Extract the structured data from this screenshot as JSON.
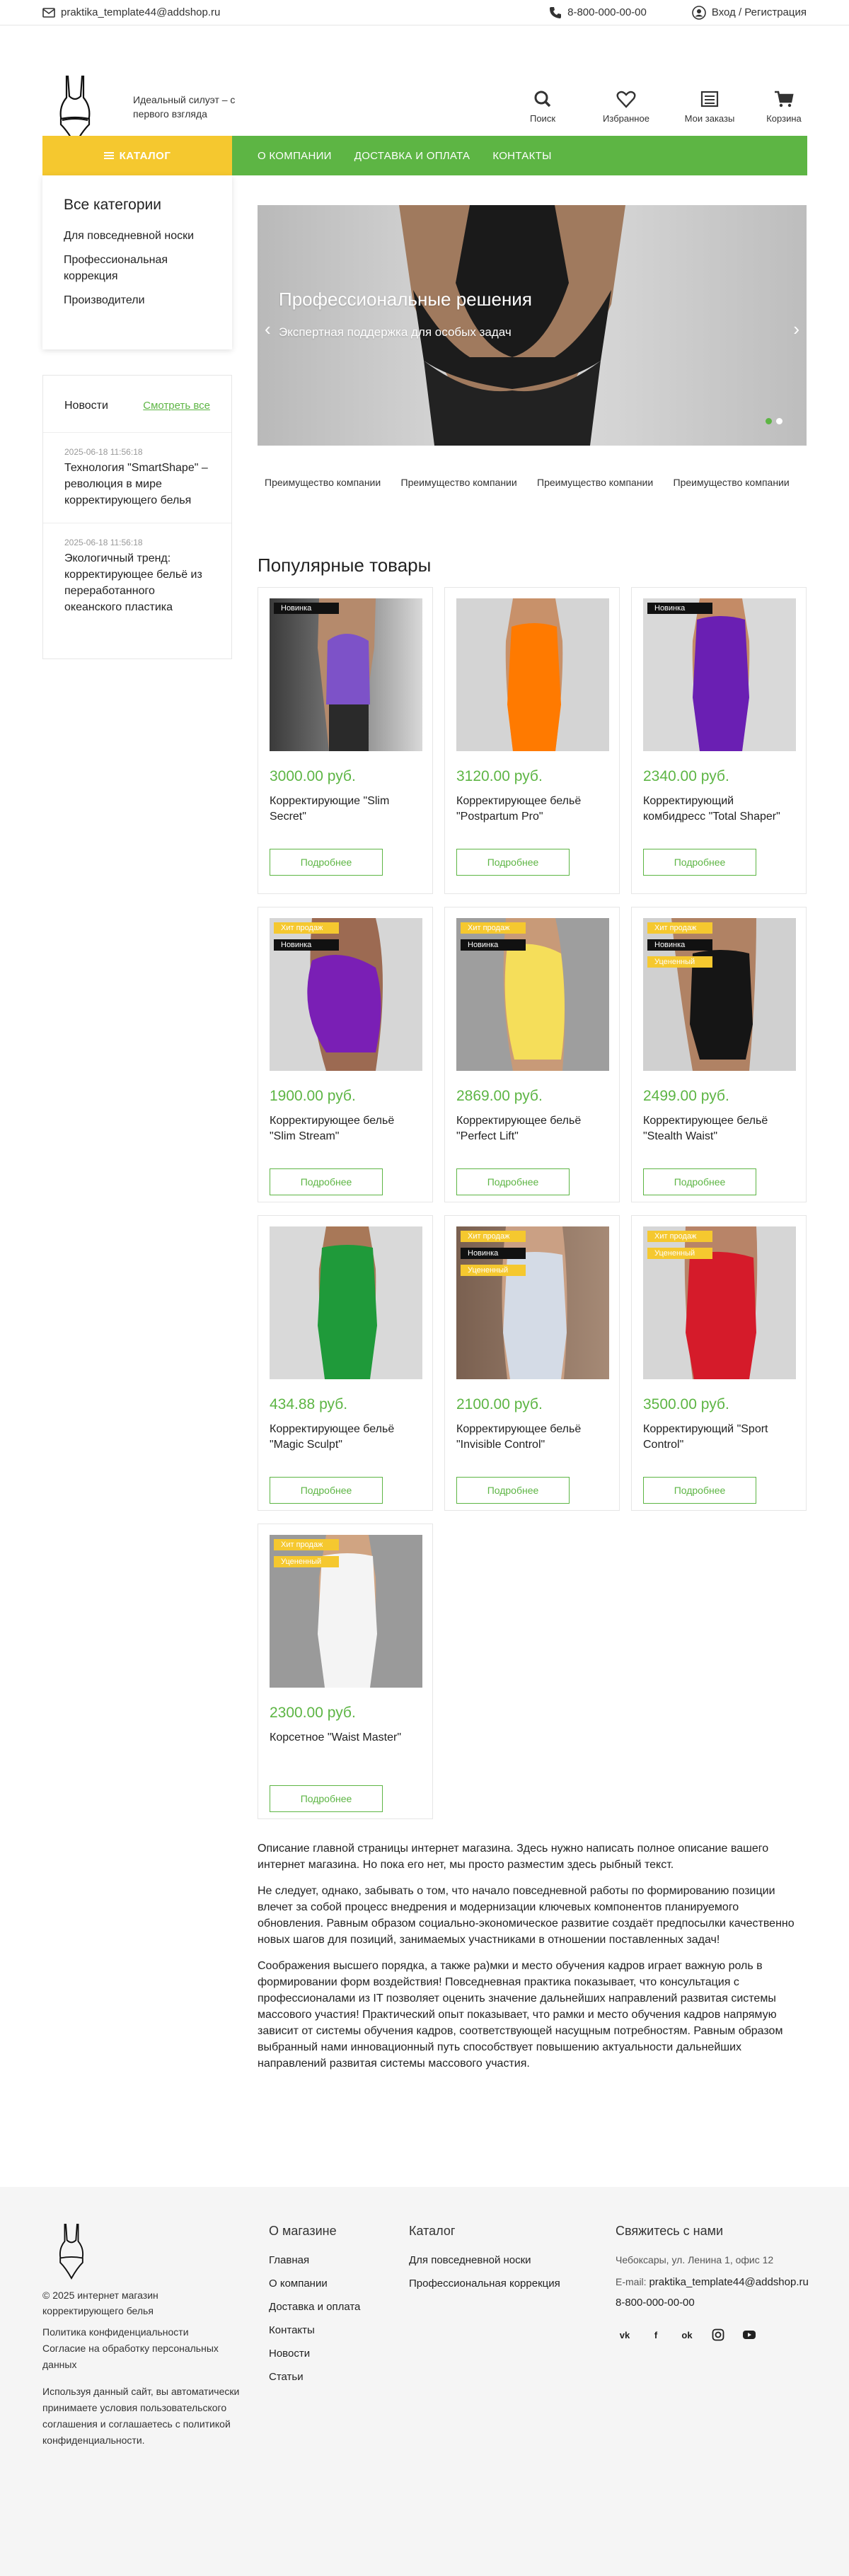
{
  "topbar": {
    "email": "praktika_template44@addshop.ru",
    "phone": "8-800-000-00-00",
    "login": "Вход / Регистрация"
  },
  "header": {
    "tagline": "Идеальный силуэт – с первого взгляда",
    "icons": {
      "search": "Поиск",
      "favorites": "Избранное",
      "orders": "Мои заказы",
      "cart": "Корзина"
    }
  },
  "nav": {
    "catalog": "КАТАЛОГ",
    "items": [
      "О КОМПАНИИ",
      "ДОСТАВКА И ОПЛАТА",
      "КОНТАКТЫ"
    ]
  },
  "categories": {
    "title": "Все категории",
    "items": [
      "Для повседневной носки",
      "Профессиональная коррекция",
      "Производители"
    ]
  },
  "news": {
    "title": "Новости",
    "all": "Смотреть все",
    "items": [
      {
        "date": "2025-06-18 11:56:18",
        "title": "Технология \"SmartShape\" – революция в мире корректирующего белья"
      },
      {
        "date": "2025-06-18 11:56:18",
        "title": "Экологичный тренд: корректирующее бельё из переработанного океанского пластика"
      }
    ]
  },
  "slider": {
    "title": "Профессиональные решения",
    "subtitle": "Экспертная поддержка для особых задач"
  },
  "advantages": [
    "Преимущество компании",
    "Преимущество компании",
    "Преимущество компании",
    "Преимущество компании"
  ],
  "popular_title": "Популярные товары",
  "badges": {
    "hit": "Хит продаж",
    "new": "Новинка",
    "disc": "Уцененный"
  },
  "button_label": "Подробнее",
  "colors": {
    "accent": "#5db544",
    "catalog": "#f5c82f"
  },
  "products": [
    {
      "price": "3000.00 руб.",
      "name": "Корректирующие \"Slim Secret\""
    },
    {
      "price": "3120.00 руб.",
      "name": "Корректирующее бельё \"Postpartum Pro\""
    },
    {
      "price": "2340.00 руб.",
      "name": "Корректирующий комбидресс \"Total Shaper\""
    },
    {
      "price": "1900.00 руб.",
      "name": "Корректирующее бельё \"Slim Stream\""
    },
    {
      "price": "2869.00 руб.",
      "name": "Корректирующее бельё \"Perfect Lift\""
    },
    {
      "price": "2499.00 руб.",
      "name": "Корректирующее бельё \"Stealth Waist\""
    },
    {
      "price": "434.88 руб.",
      "name": "Корректирующее бельё \"Magic Sculpt\""
    },
    {
      "price": "2100.00 руб.",
      "name": "Корректирующее бельё \"Invisible Control\""
    },
    {
      "price": "3500.00 руб.",
      "name": "Корректирующий \"Sport Control\""
    },
    {
      "price": "2300.00 руб.",
      "name": "Корсетное \"Waist Master\""
    }
  ],
  "description": [
    "Описание главной страницы интернет магазина. Здесь нужно написать полное описание вашего интернет магазина. Но пока его нет, мы просто разместим здесь рыбный текст.",
    "Не следует, однако, забывать о том, что начало повседневной работы по формированию позиции влечет за собой процесс внедрения и модернизации ключевых компонентов планируемого обновления. Равным образом социально-экономическое развитие создаёт предпосылки качественно новых шагов для позиций, занимаемых участниками в отношении поставленных задач!",
    "Соображения высшего порядка, а также ра)мки и место обучения кадров играет важную роль в формировании форм воздействия! Повседневная практика показывает, что консультация с профессионалами из IT позволяет оценить значение дальнейших направлений развитая системы массового участия! Практический опыт показывает, что рамки и место обучения кадров напрямую зависит от системы обучения кадров, соответствующей насущным потребностям. Равным образом выбранный нами инновационный путь способствует повышению актуальности дальнейших направлений развитая системы массового участия."
  ],
  "footer": {
    "copyright": "© 2025 интернет магазин корректирующего белья",
    "links": [
      "Политика конфиденциальности",
      "Согласие на обработку персональных данных"
    ],
    "note": "Используя данный сайт, вы автоматически принимаете условия пользовательского соглашения и соглашаетесь с политикой конфиденциальности.",
    "about": {
      "title": "О магазине",
      "items": [
        "Главная",
        "О компании",
        "Доставка и оплата",
        "Контакты",
        "Новости",
        "Статьи"
      ]
    },
    "catalog": {
      "title": "Каталог",
      "items": [
        "Для повседневной носки",
        "Профессиональная коррекция"
      ]
    },
    "contacts": {
      "title": "Свяжитесь с нами",
      "address": "Чебоксары, ул. Ленина 1, офис 12",
      "email_label": "E-mail:",
      "email": "praktika_template44@addshop.ru",
      "phone": "8-800-000-00-00"
    },
    "socials": [
      "vk-icon",
      "facebook-icon",
      "odnoklassniki-icon",
      "instagram-icon",
      "youtube-icon"
    ]
  }
}
